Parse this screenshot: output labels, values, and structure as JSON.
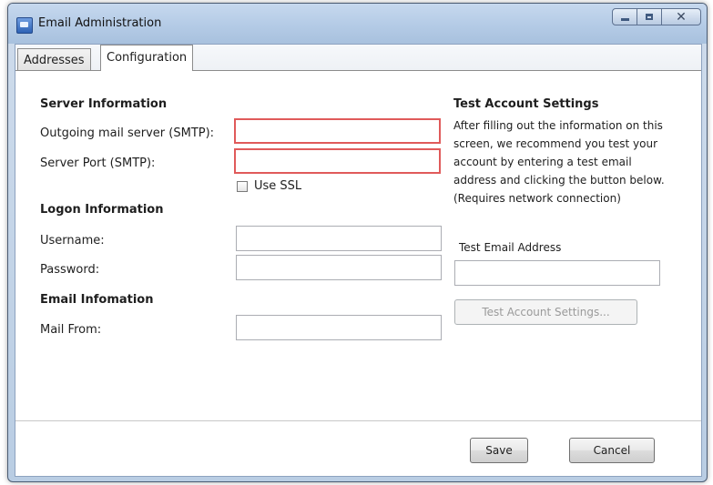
{
  "window": {
    "title": "Email Administration"
  },
  "tabs": [
    {
      "label": "Addresses",
      "active": false
    },
    {
      "label": "Configuration",
      "active": true
    }
  ],
  "server": {
    "heading": "Server Information",
    "smtp_label": "Outgoing mail server (SMTP):",
    "smtp_value": "",
    "port_label": "Server Port (SMTP):",
    "port_value": "",
    "ssl_label": "Use SSL",
    "ssl_checked": false
  },
  "logon": {
    "heading": "Logon Information",
    "username_label": "Username:",
    "username_value": "",
    "password_label": "Password:",
    "password_value": ""
  },
  "email": {
    "heading": "Email Infomation",
    "mail_from_label": "Mail From:",
    "mail_from_value": ""
  },
  "test": {
    "heading": "Test Account Settings",
    "help_lines": [
      "After filling out the information on this",
      "screen, we recommend you test your",
      "account by entering a test email",
      "address and clicking the button below.",
      "(Requires network connection)"
    ],
    "address_label": "Test Email Address",
    "address_value": "",
    "button_label": "Test Account Settings...",
    "button_enabled": false
  },
  "footer": {
    "save_label": "Save",
    "cancel_label": "Cancel"
  },
  "colors": {
    "error_border": "#e05a5a",
    "titlebar": "#b4cbe6"
  }
}
